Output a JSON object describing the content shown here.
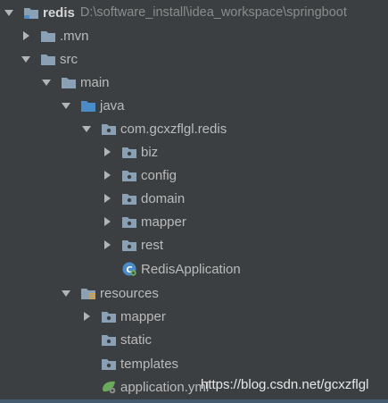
{
  "tree": {
    "root": {
      "label": "redis",
      "path": "D:\\software_install\\idea_workspace\\springboot",
      "icon": "module-folder-icon"
    },
    "mvn": {
      "label": ".mvn",
      "icon": "folder-icon"
    },
    "src": {
      "label": "src",
      "icon": "folder-icon"
    },
    "main": {
      "label": "main",
      "icon": "folder-icon"
    },
    "java": {
      "label": "java",
      "icon": "source-root-folder-icon"
    },
    "package": {
      "label": "com.gcxzflgl.redis",
      "icon": "package-icon"
    },
    "biz": {
      "label": "biz",
      "icon": "package-icon"
    },
    "config": {
      "label": "config",
      "icon": "package-icon"
    },
    "domain": {
      "label": "domain",
      "icon": "package-icon"
    },
    "mapper": {
      "label": "mapper",
      "icon": "package-icon"
    },
    "rest": {
      "label": "rest",
      "icon": "package-icon"
    },
    "app": {
      "label": "RedisApplication",
      "icon": "spring-boot-class-icon"
    },
    "resources": {
      "label": "resources",
      "icon": "resources-root-folder-icon"
    },
    "res_mapper": {
      "label": "mapper",
      "icon": "package-icon"
    },
    "static": {
      "label": "static",
      "icon": "package-icon"
    },
    "templates": {
      "label": "templates",
      "icon": "package-icon"
    },
    "appyml": {
      "label": "application.yml",
      "icon": "spring-yml-icon"
    }
  },
  "watermark": "https://blog.csdn.net/gcxzflgl",
  "colors": {
    "background": "#3c3f41",
    "text": "#bbbbbb",
    "path": "#8c8c8c",
    "folder": "#8aa0b4",
    "source_root": "#4a8cc7",
    "arrow": "#b4b4b4",
    "spring": "#6aab5b"
  }
}
